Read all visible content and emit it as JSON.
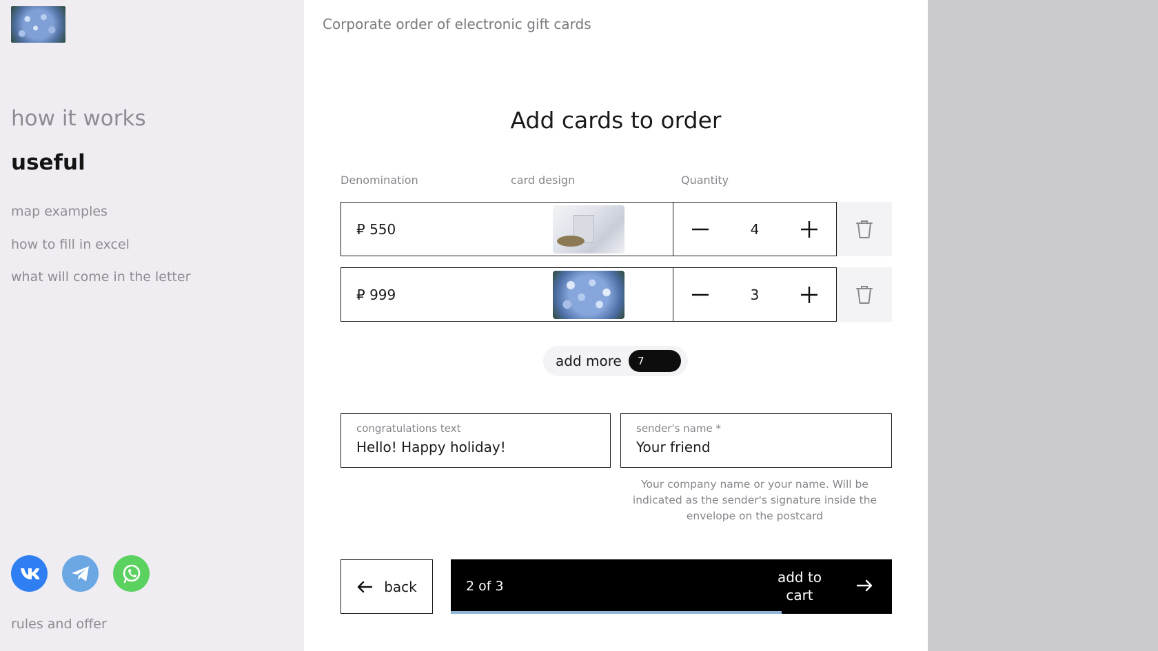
{
  "sidebar": {
    "nav_how": "how it works",
    "nav_useful": "useful",
    "links": [
      "map examples",
      "how to fill in excel",
      "what will come in the letter"
    ],
    "rules": "rules and offer",
    "socials": [
      "vk-icon",
      "telegram-icon",
      "whatsapp-icon"
    ]
  },
  "main": {
    "breadcrumb": "Corporate order of electronic gift cards",
    "heading": "Add cards to order",
    "columns": [
      "Denomination",
      "card design",
      "Quantity"
    ],
    "rows": [
      {
        "denomination": "₽ 550",
        "design": "gift-card-image",
        "quantity": "4"
      },
      {
        "denomination": "₽ 999",
        "design": "hydrangea-card-image",
        "quantity": "3"
      }
    ],
    "add_more": {
      "label": "add more",
      "count": "7"
    },
    "congrats": {
      "label": "congratulations text",
      "value": "Hello! Happy holiday!"
    },
    "sender": {
      "label": "sender's name *",
      "value": "Your friend"
    },
    "hint": "Your company name or your name. Will be indicated as the sender's signature inside the envelope on the postcard",
    "back": "back",
    "step": "2 of 3",
    "add_to_cart": "add to cart",
    "progress_fraction": 0.75
  },
  "colors": {
    "sidebar_bg": "#efedf2",
    "right_bg": "#cbcacd",
    "progress": "#8fb4d8",
    "vk": "#2f7ff2",
    "telegram": "#6ba7e2",
    "whatsapp": "#5bd160"
  }
}
